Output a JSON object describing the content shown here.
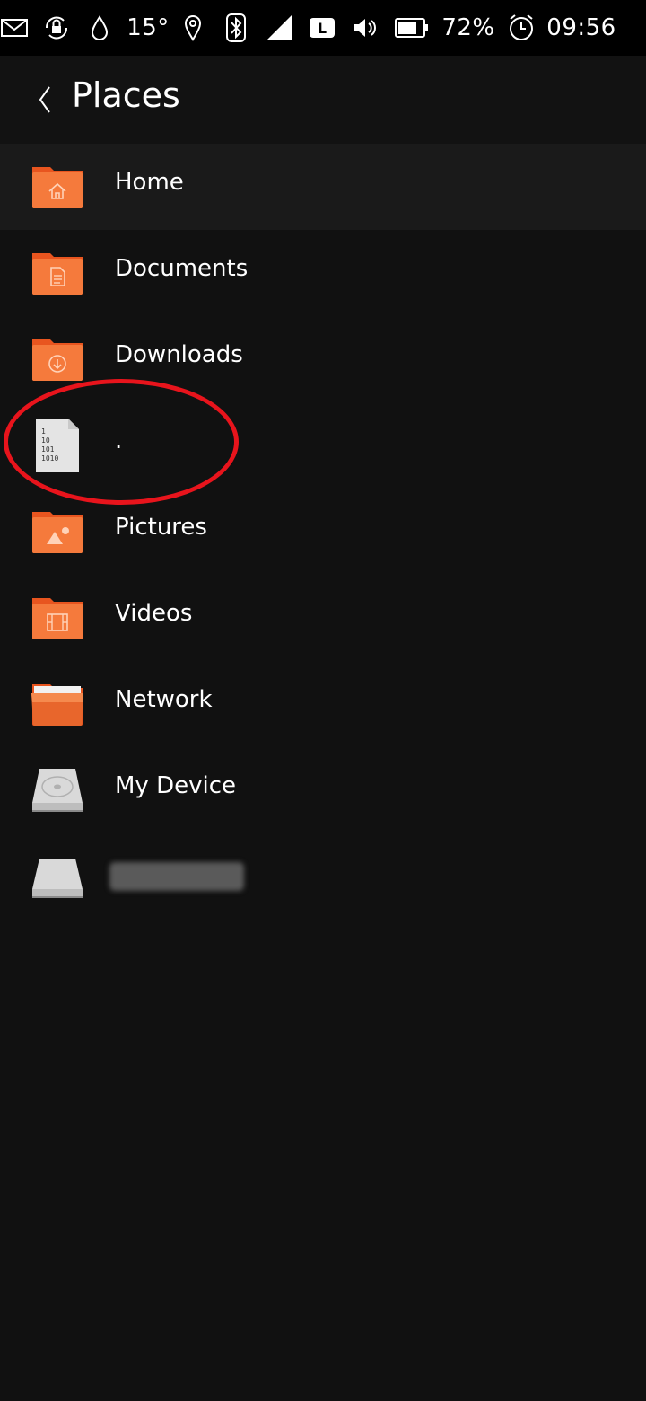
{
  "status_bar": {
    "temperature": "15°",
    "battery": "72%",
    "time": "09:56",
    "network_label": "L",
    "icons": [
      "mail-icon",
      "rotation-lock-icon",
      "droplet-icon",
      "location-icon",
      "bluetooth-icon",
      "signal-icon",
      "lte-icon",
      "volume-icon",
      "battery-icon",
      "alarm-icon"
    ]
  },
  "header": {
    "title": "Places",
    "back_icon": "chevron-left-icon"
  },
  "places": [
    {
      "label": "Home",
      "icon": "home-folder-icon",
      "selected": true
    },
    {
      "label": "Documents",
      "icon": "documents-folder-icon"
    },
    {
      "label": "Downloads",
      "icon": "downloads-folder-icon"
    },
    {
      "label": ".",
      "icon": "binary-file-icon"
    },
    {
      "label": "Pictures",
      "icon": "pictures-folder-icon"
    },
    {
      "label": "Videos",
      "icon": "videos-folder-icon"
    },
    {
      "label": "Network",
      "icon": "network-folder-icon"
    },
    {
      "label": "My Device",
      "icon": "hard-drive-icon"
    },
    {
      "label": "",
      "icon": "removable-drive-icon",
      "blurred": true
    }
  ],
  "colors": {
    "folder_orange": "#f26b2c",
    "folder_orange_light": "#f58a4e",
    "annotation_red": "#e8141c",
    "background": "#111111"
  }
}
